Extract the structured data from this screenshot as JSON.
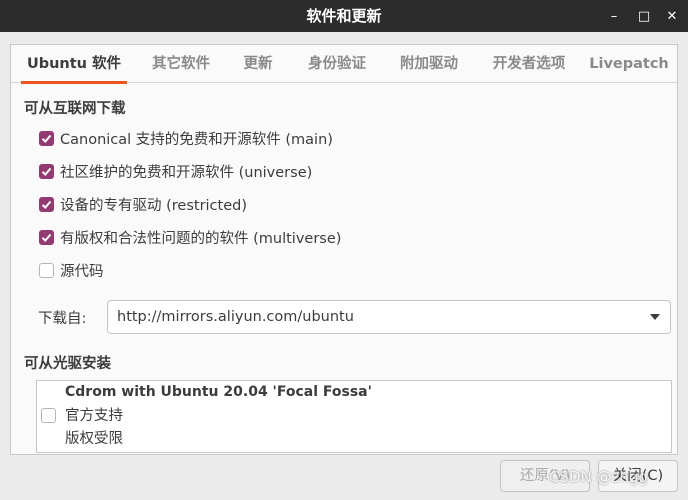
{
  "window": {
    "title": "软件和更新",
    "minimize_glyph": "–",
    "maximize_glyph": "□",
    "close_glyph": "✕"
  },
  "tabs": [
    {
      "label": "Ubuntu 软件",
      "active": true
    },
    {
      "label": "其它软件",
      "active": false
    },
    {
      "label": "更新",
      "active": false
    },
    {
      "label": "身份验证",
      "active": false
    },
    {
      "label": "附加驱动",
      "active": false
    },
    {
      "label": "开发者选项",
      "active": false
    },
    {
      "label": "Livepatch",
      "active": false
    }
  ],
  "internet": {
    "heading": "可从互联网下载",
    "options": [
      {
        "label": "Canonical 支持的免费和开源软件 (main)",
        "checked": true
      },
      {
        "label": "社区维护的免费和开源软件 (universe)",
        "checked": true
      },
      {
        "label": "设备的专有驱动 (restricted)",
        "checked": true
      },
      {
        "label": "有版权和合法性问题的的软件 (multiverse)",
        "checked": true
      },
      {
        "label": "源代码",
        "checked": false
      }
    ],
    "download_from_label": "下载自:",
    "download_from_value": "http://mirrors.aliyun.com/ubuntu"
  },
  "cdrom": {
    "heading": "可从光驱安装",
    "title": "Cdrom with Ubuntu 20.04 'Focal Fossa'",
    "line1": "官方支持",
    "line2": "版权受限",
    "checked": false
  },
  "buttons": {
    "revert": "还原(V)",
    "close": "关闭(C)"
  },
  "watermark": "CSDN @zhgg",
  "colors": {
    "accent": "#e95420",
    "checkbox": "#923b72",
    "titlebar": "#2c2c2c"
  }
}
